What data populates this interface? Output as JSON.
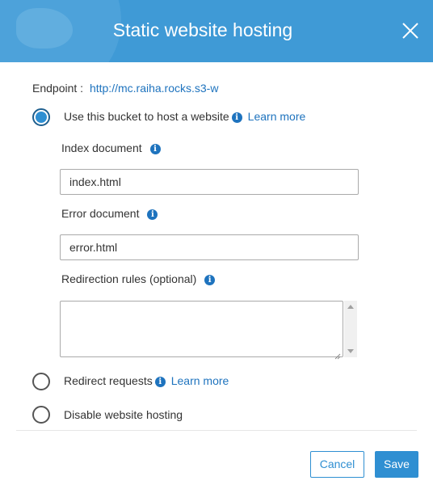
{
  "dialog": {
    "title": "Static website hosting",
    "close_icon": "close-icon"
  },
  "endpoint": {
    "label": "Endpoint :",
    "url": "http://mc.raiha.rocks.s3-w"
  },
  "options": [
    {
      "label": "Use this bucket to host a website",
      "learn_more": "Learn more",
      "selected": true
    },
    {
      "label": "Redirect requests",
      "learn_more": "Learn more",
      "selected": false
    },
    {
      "label": "Disable website hosting",
      "selected": false
    }
  ],
  "fields": {
    "index_document": {
      "label": "Index document",
      "value": "index.html"
    },
    "error_document": {
      "label": "Error document",
      "value": "error.html"
    },
    "redirection_rules": {
      "label": "Redirection rules (optional)",
      "value": ""
    }
  },
  "buttons": {
    "cancel": "Cancel",
    "save": "Save"
  },
  "colors": {
    "header": "#3f9ad6",
    "accent": "#2f8fd2",
    "link": "#1e73be"
  }
}
